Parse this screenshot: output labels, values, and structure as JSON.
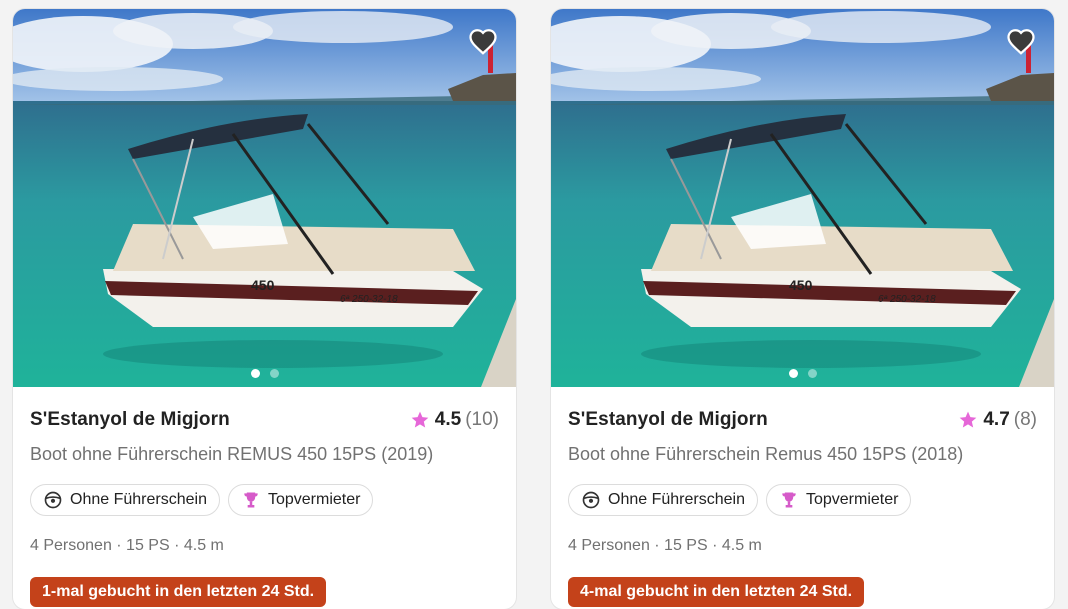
{
  "colors": {
    "star": "#e667d8",
    "trophy": "#d65bc9",
    "booked_badge": "#c4421a"
  },
  "cards": [
    {
      "location": "S'Estanyol de Migjorn",
      "rating": "4.5",
      "reviews": "(10)",
      "subtitle": "Boot ohne Führerschein REMUS 450 15PS (2019)",
      "tags": [
        "Ohne Führerschein",
        "Topvermieter"
      ],
      "specs": "4 Personen · 15 PS · 4.5 m",
      "booked": "1-mal gebucht in den letzten 24 Std.",
      "boat_label": "450",
      "boat_reg": "6ª 250-32-18"
    },
    {
      "location": "S'Estanyol de Migjorn",
      "rating": "4.7",
      "reviews": "(8)",
      "subtitle": "Boot ohne Führerschein Remus 450 15PS (2018)",
      "tags": [
        "Ohne Führerschein",
        "Topvermieter"
      ],
      "specs": "4 Personen · 15 PS · 4.5 m",
      "booked": "4-mal gebucht in den letzten 24 Std.",
      "boat_label": "450",
      "boat_reg": "6ª 250-32-18"
    }
  ],
  "icons": {
    "favorite": "heart-icon",
    "rating": "star-icon",
    "license": "steering-wheel-icon",
    "top_host": "trophy-icon"
  }
}
